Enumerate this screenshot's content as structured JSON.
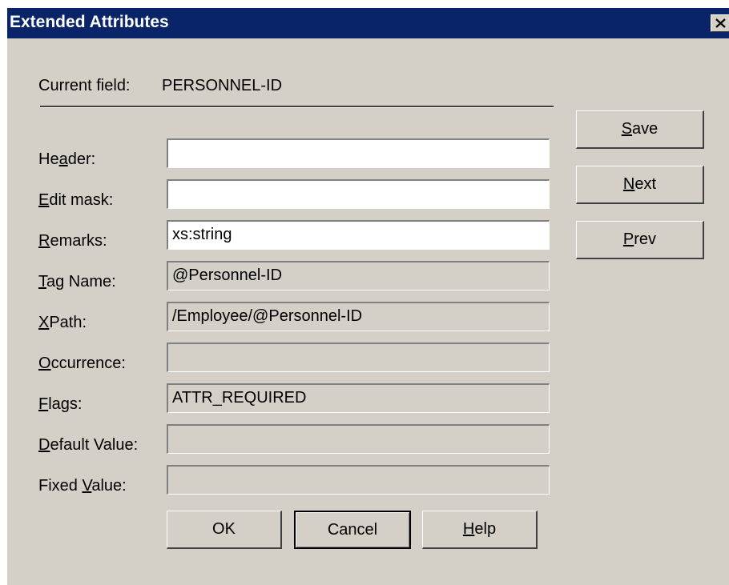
{
  "window": {
    "title": "Extended Attributes",
    "close_icon": "close-icon"
  },
  "current_field": {
    "label": "Current field:",
    "value": "PERSONNEL-ID"
  },
  "fields": [
    {
      "label_pre": "He",
      "label_key": "a",
      "label_post": "der:",
      "value": "",
      "editable": true
    },
    {
      "label_pre": "",
      "label_key": "E",
      "label_post": "dit mask:",
      "value": "",
      "editable": true
    },
    {
      "label_pre": "",
      "label_key": "R",
      "label_post": "emarks:",
      "value": "xs:string",
      "editable": true
    },
    {
      "label_pre": "",
      "label_key": "T",
      "label_post": "ag Name:",
      "value": "@Personnel-ID",
      "editable": false
    },
    {
      "label_pre": "",
      "label_key": "X",
      "label_post": "Path:",
      "value": "/Employee/@Personnel-ID",
      "editable": false
    },
    {
      "label_pre": "",
      "label_key": "O",
      "label_post": "ccurrence:",
      "value": "",
      "editable": false
    },
    {
      "label_pre": "",
      "label_key": "F",
      "label_post": "lags:",
      "value": "ATTR_REQUIRED",
      "editable": false
    },
    {
      "label_pre": "",
      "label_key": "D",
      "label_post": "efault Value:",
      "value": "",
      "editable": false
    },
    {
      "label_pre": "Fixed ",
      "label_key": "V",
      "label_post": "alue:",
      "value": "",
      "editable": false
    }
  ],
  "side_buttons": {
    "save": {
      "key": "S",
      "rest": "ave"
    },
    "next": {
      "key": "N",
      "rest": "ext"
    },
    "prev": {
      "key": "P",
      "rest": "rev"
    }
  },
  "bottom_buttons": {
    "ok": "OK",
    "cancel": "Cancel",
    "help": {
      "key": "H",
      "rest": "elp"
    }
  }
}
